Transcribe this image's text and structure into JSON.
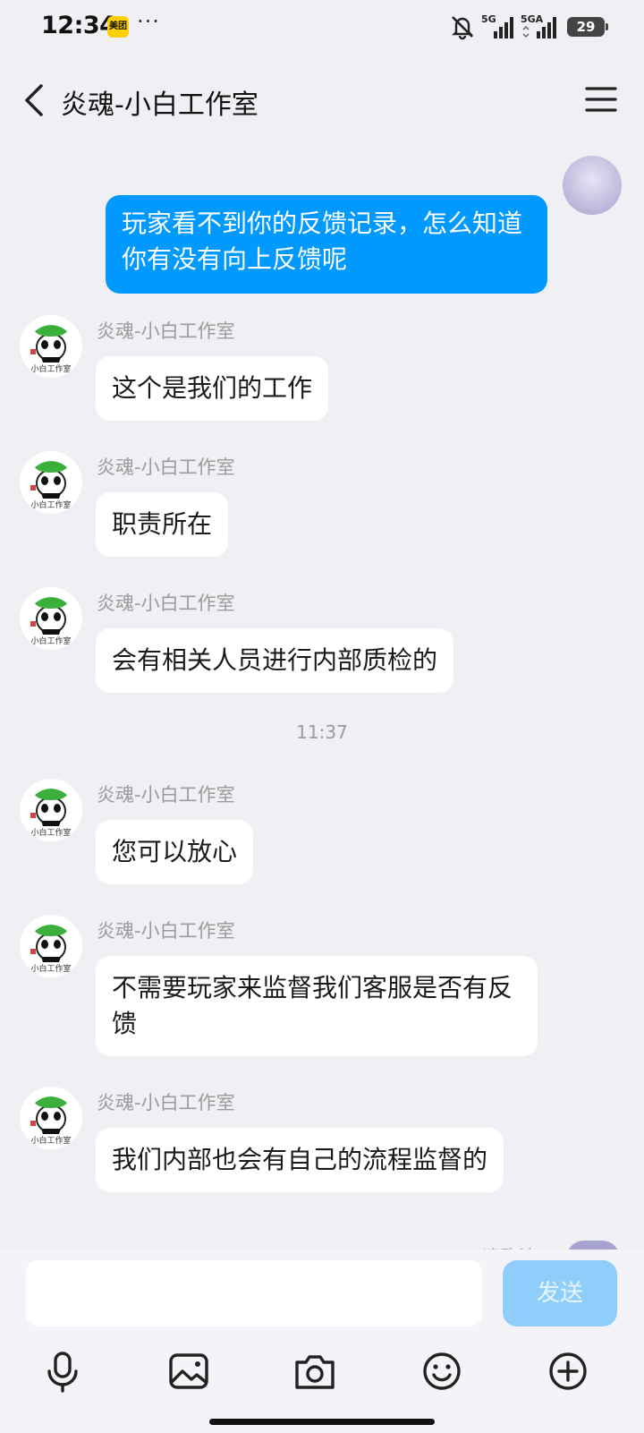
{
  "status_bar": {
    "time": "12:34",
    "app_badge": "美团",
    "more": "···",
    "signal1_label": "5G",
    "signal2_label": "5GA",
    "battery": "29"
  },
  "header": {
    "title": "炎魂-小白工作室"
  },
  "messages": {
    "outgoing_1": "玩家看不到你的反馈记录，怎么知道你有没有向上反馈呢",
    "sender_name": "炎魂-小白工作室",
    "incoming": [
      {
        "sender": "炎魂-小白工作室",
        "text": "这个是我们的工作"
      },
      {
        "sender": "炎魂-小白工作室",
        "text": "职责所在"
      },
      {
        "sender": "炎魂-小白工作室",
        "text": "会有相关人员进行内部质检的"
      },
      {
        "sender": "炎魂-小白工作室",
        "text": "您可以放心"
      },
      {
        "sender": "炎魂-小白工作室",
        "text": "不需要玩家来监督我们客服是否有反馈"
      },
      {
        "sender": "炎魂-小白工作室",
        "text": "我们内部也会有自己的流程监督的"
      }
    ],
    "timestamp": "11:37",
    "partial_name": "凄殇流"
  },
  "input": {
    "value": "",
    "placeholder": "",
    "send_label": "发送"
  },
  "colors": {
    "accent": "#0099ff",
    "send_disabled": "#8fcdfb",
    "background": "#efeff4"
  },
  "icons": [
    "back-icon",
    "menu-icon",
    "microphone-icon",
    "image-icon",
    "camera-icon",
    "emoji-icon",
    "plus-icon"
  ]
}
